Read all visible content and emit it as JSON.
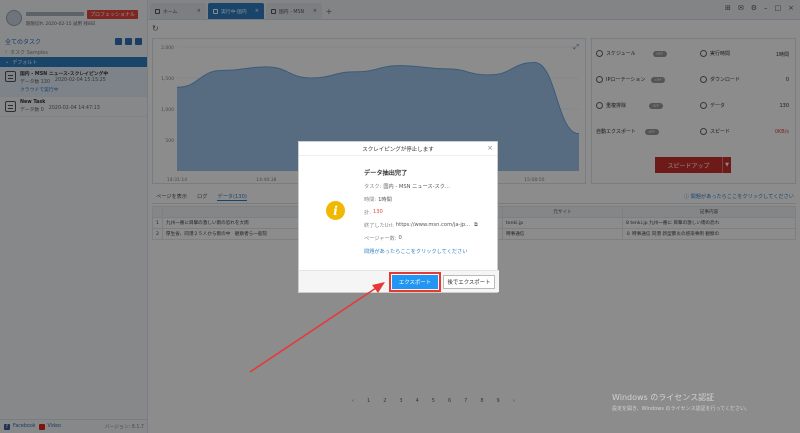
{
  "account": {
    "badge": "プロフェッショナル",
    "sub": "期限切れ 2020-02-15 試用 残8日"
  },
  "sidebar": {
    "all_tasks": "全てのタスク",
    "groups": [
      {
        "label": "タスク Samples"
      },
      {
        "label": "デフォルト"
      }
    ],
    "tasks": [
      {
        "name": "国内 - MSN ニュース-スクレイピング中",
        "count_label": "データ数",
        "count": "130",
        "date": "2020-02-04 15:15:25",
        "link": "クラウドで実行中"
      },
      {
        "name": "New Task",
        "count_label": "データ数",
        "count": "0",
        "date": "2020-02-04 14:47:13"
      }
    ],
    "footer": {
      "facebook": "Facebook",
      "video": "Video",
      "version": "バージョン: 8.1.7"
    }
  },
  "tabs": [
    {
      "label": "ホーム"
    },
    {
      "label": "実行中-国内"
    },
    {
      "label": "国内 - MSN"
    }
  ],
  "stats": {
    "schedule": {
      "label": "スケジュール",
      "toggle": "OFF"
    },
    "run_time": {
      "label": "実行時間",
      "value": "1時間"
    },
    "ip_rotation": {
      "label": "IPローテーション",
      "toggle": "OFF"
    },
    "download": {
      "label": "ダウンロード",
      "value": "0"
    },
    "dedupe": {
      "label": "重複排除",
      "toggle": "OFF"
    },
    "data": {
      "label": "データ",
      "value": "130"
    },
    "auto_export": {
      "label": "自動エクスポート",
      "toggle": "OFF"
    },
    "speed": {
      "label": "スピード",
      "value": "0KB/s"
    },
    "speedup_label": "スピードアップ"
  },
  "data_tabs": {
    "items": [
      "ページを表示",
      "ログ",
      "データ(130)"
    ],
    "help": "問題があったらここをクリックしてください"
  },
  "table": {
    "headers": [
      "",
      "タイトル",
      "元サイト",
      "記事内容"
    ],
    "rows": [
      [
        "1",
        "九州一番に目撃の激しい雨の恐れを大雨",
        "tenki.jp",
        "8 tenki.jp 九州一番に 目撃の激しい雨の恐れ"
      ],
      [
        "2",
        "厚生省、同港２５人から雨の中　観察者ら一般院",
        "時事通信",
        "８ 時事通信 同港 新型肺炎の感染事例 観察の"
      ]
    ]
  },
  "pager": [
    "1",
    "2",
    "3",
    "4",
    "5",
    "6",
    "7",
    "8",
    "9"
  ],
  "watermark": {
    "line1": "Windows のライセンス認証",
    "line2": "設定を開き、Windows のライセンス認証を行ってください。"
  },
  "modal": {
    "title": "スクレイピングが停止します",
    "heading": "データ抽出完了",
    "task_key": "タスク:",
    "task_val": "国内 - MSN ニュース-スク...",
    "time_key": "時間:",
    "time_val": "1時間",
    "total_key": "計:",
    "total_val": "130",
    "url_key": "終了したUrl:",
    "url_val": "https://www.msn.com/ja-jp...",
    "page_key": "ページャー数:",
    "page_val": "0",
    "help_link": "問題があったらここをクリックしてください",
    "export_btn": "エクスポート",
    "later_btn": "後でエクスポート"
  },
  "chart_data": {
    "type": "area",
    "x": [
      "14:31:14",
      "14:35:56",
      "14:40:38",
      "14:45:20",
      "14:50:02",
      "14:54:44",
      "14:59:26",
      "15:04:08",
      "15:08:50",
      "15:13:32"
    ],
    "y": [
      1350,
      1620,
      1680,
      1500,
      1600,
      1700,
      1650,
      1550,
      1750,
      600
    ],
    "ylim": [
      0,
      2000
    ],
    "yticks": [
      "2,000",
      "1,500",
      "1,000",
      "500"
    ],
    "xticks": [
      "14:31:14",
      "14:40:38",
      "14:50:02",
      "14:59:26",
      "15:08:50"
    ],
    "fill_color": "#9ec5ea",
    "line_color": "#6aa6df"
  },
  "colors": {
    "accent": "#2f7fc4",
    "danger": "#c9302c",
    "warn": "#f0b800"
  }
}
